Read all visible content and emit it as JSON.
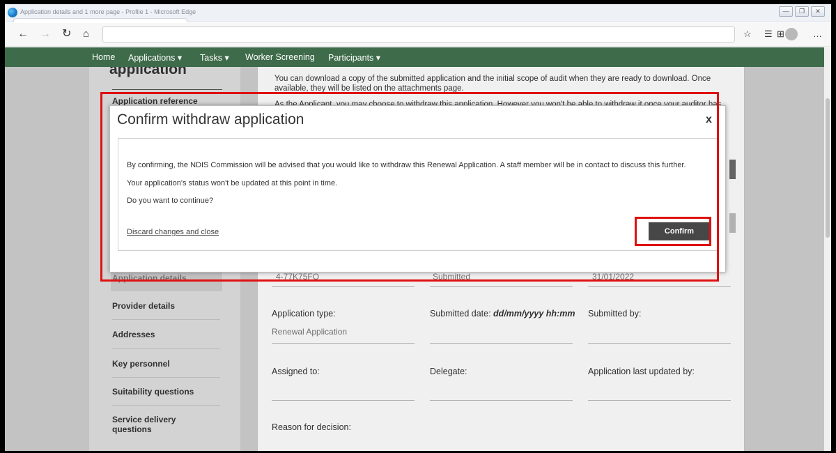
{
  "window": {
    "title": "Application details and 1 more page - Profile 1 - Microsoft Edge"
  },
  "nav": {
    "home": "Home",
    "applications": "Applications",
    "tasks": "Tasks",
    "worker_screening": "Worker Screening",
    "participants": "Participants",
    "dropdown_caret": "▾"
  },
  "background": {
    "heading_fragment": "application",
    "application_reference_label": "Application reference",
    "info_line1": "You can download a copy of the submitted application and the initial scope of audit when they are ready to download. Once available, they will be listed on the attachments page.",
    "info_line2": "As the Applicant, you may choose to withdraw this application. However you won't be able to withdraw it once your auditor has",
    "reference_value": "4-77K75FO",
    "status_value": "Submitted",
    "date_value": "31/01/2022",
    "sidebar_items": [
      "Application details",
      "Provider details",
      "Addresses",
      "Key personnel",
      "Suitability questions",
      "Service delivery questions"
    ],
    "fields": {
      "application_type_label": "Application type:",
      "application_type_value": "Renewal Application",
      "submitted_date_label": "Submitted date:",
      "submitted_date_format": "dd/mm/yyyy hh:mm",
      "submitted_by_label": "Submitted by:",
      "assigned_to_label": "Assigned to:",
      "delegate_label": "Delegate:",
      "last_updated_label": "Application last updated by:",
      "reason_label": "Reason for decision:"
    }
  },
  "modal": {
    "title": "Confirm withdraw application",
    "close": "x",
    "line1": "By confirming, the NDIS Commission will be advised that you would like to withdraw this Renewal Application. A staff member will be in contact to discuss this further.",
    "line2": "Your application's status won't be updated at this point in time.",
    "line3": "Do you want to continue?",
    "discard_label": "Discard changes and close",
    "confirm_label": "Confirm"
  },
  "colors": {
    "nav_green": "#3e6b4a",
    "confirm_button": "#474747",
    "highlight_red": "#e01010"
  }
}
